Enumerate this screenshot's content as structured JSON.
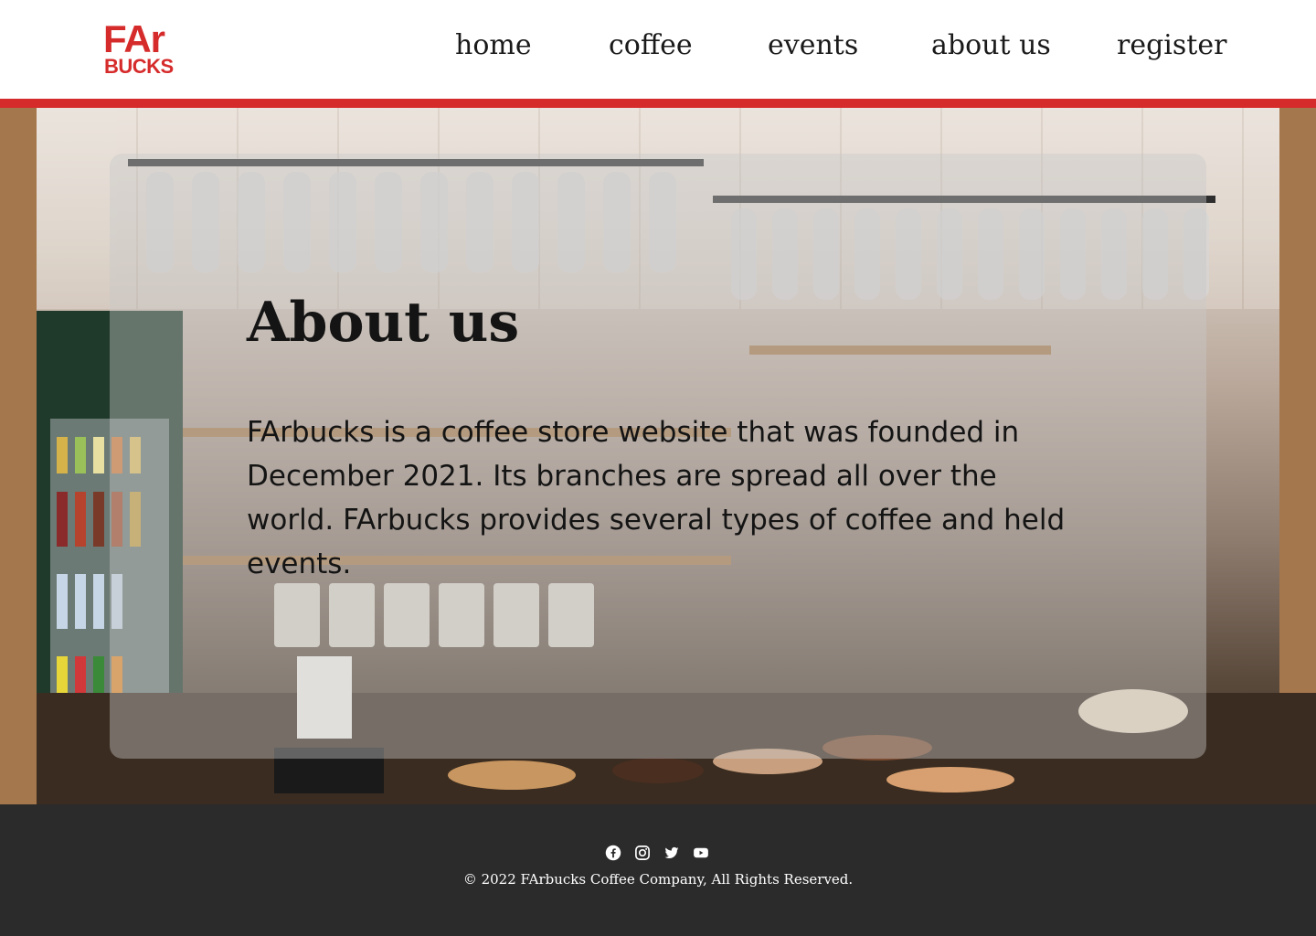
{
  "header": {
    "logo": {
      "line1": "FAr",
      "line2": "BUCKS"
    },
    "nav": [
      {
        "label": "home"
      },
      {
        "label": "coffee"
      },
      {
        "label": "events"
      },
      {
        "label": "about us"
      },
      {
        "label": "register"
      }
    ]
  },
  "hero": {
    "title": "About us",
    "body": "FArbucks is a coffee store website that was founded in December 2021. Its branches are spread all over the world. FArbucks provides several types of coffee and held events."
  },
  "footer": {
    "social_icons": [
      "facebook-icon",
      "instagram-icon",
      "twitter-icon",
      "youtube-icon"
    ],
    "copyright": "© 2022 FArbucks Coffee Company, All Rights Reserved."
  },
  "colors": {
    "brand_red": "#d62b2b",
    "footer_bg": "#2b2b2b",
    "text_dark": "#141414"
  }
}
